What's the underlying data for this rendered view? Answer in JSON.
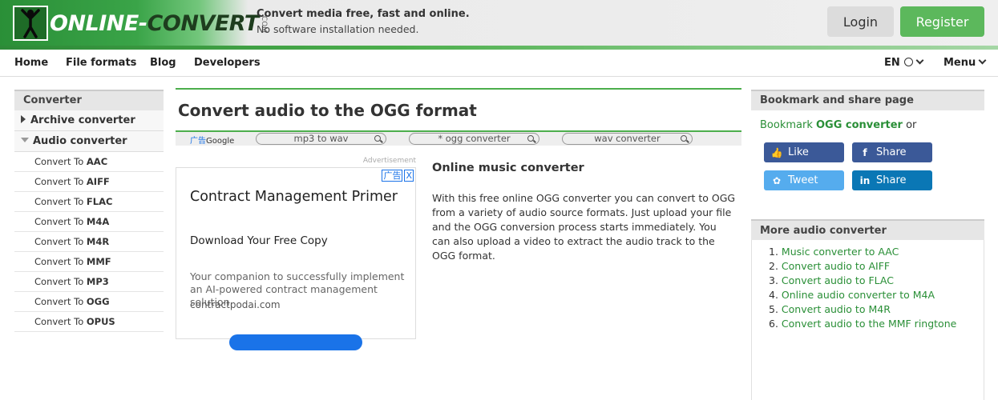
{
  "header": {
    "logo": {
      "online": "ONLINE-",
      "con": "CON",
      "vert": "VERT",
      "com": ".COM"
    },
    "tagline": "Convert media free, fast and online.",
    "subtagline": "No software installation needed.",
    "login_label": "Login",
    "register_label": "Register"
  },
  "nav": {
    "items": [
      {
        "label": "Home"
      },
      {
        "label": "File formats"
      },
      {
        "label": "Blog"
      },
      {
        "label": "Developers"
      }
    ],
    "language_label": "EN",
    "menu_label": "Menu"
  },
  "sidebar": {
    "heading": "Converter",
    "archive_label": "Archive converter",
    "audio_label": "Audio converter",
    "links": [
      {
        "prefix": "Convert To ",
        "format": "AAC"
      },
      {
        "prefix": "Convert To ",
        "format": "AIFF"
      },
      {
        "prefix": "Convert To ",
        "format": "FLAC"
      },
      {
        "prefix": "Convert To ",
        "format": "M4A"
      },
      {
        "prefix": "Convert To ",
        "format": "M4R"
      },
      {
        "prefix": "Convert To ",
        "format": "MMF"
      },
      {
        "prefix": "Convert To ",
        "format": "MP3"
      },
      {
        "prefix": "Convert To ",
        "format": "OGG"
      },
      {
        "prefix": "Convert To ",
        "format": "OPUS"
      }
    ]
  },
  "main": {
    "title": "Convert audio to the OGG format",
    "adbar": {
      "google_cn": "广告",
      "google": "Google",
      "searches": [
        "mp3 to wav",
        "* ogg converter",
        "wav converter"
      ]
    },
    "ad": {
      "label": "Advertisement",
      "choices": "广告",
      "close": "X",
      "headline": "Contract Management Primer",
      "subheadline": "Download Your Free Copy",
      "body": "Your companion to successfully implement an AI-powered contract management solution.",
      "domain": "contractpodai.com"
    },
    "section": {
      "heading": "Online music converter",
      "body": "With this free online OGG converter you can convert to OGG from a variety of audio source formats. Just upload your file and the OGG conversion process starts immediately. You can also upload a video to extract the audio track to the OGG format."
    }
  },
  "right": {
    "bookmark_heading": "Bookmark and share page",
    "bookmark_prefix": "Bookmark ",
    "bookmark_strong": "OGG converter",
    "bookmark_suffix": " or",
    "share": {
      "facebook_like": "Like",
      "facebook_share": "Share",
      "twitter": "Tweet",
      "linkedin": "Share"
    },
    "more_heading": "More audio converter",
    "more_items": [
      {
        "num": "1.",
        "label": "Music converter to AAC"
      },
      {
        "num": "2.",
        "label": "Convert audio to AIFF"
      },
      {
        "num": "3.",
        "label": "Convert audio to FLAC"
      },
      {
        "num": "4.",
        "label": "Online audio converter to M4A"
      },
      {
        "num": "5.",
        "label": "Convert audio to M4R"
      },
      {
        "num": "6.",
        "label": "Convert audio to the MMF ringtone"
      }
    ]
  },
  "colors": {
    "brand_green": "#2a8f37",
    "register_green": "#5cb85c",
    "facebook": "#3b5998",
    "twitter": "#55acee",
    "linkedin": "#0a77b5"
  },
  "icons": {
    "logo_mark": "person-arms-up-icon",
    "language": "globe-icon",
    "dropdown": "chevron-down-icon",
    "search": "search-icon",
    "facebook": "facebook-icon",
    "twitter": "twitter-icon",
    "linkedin": "linkedin-icon"
  }
}
